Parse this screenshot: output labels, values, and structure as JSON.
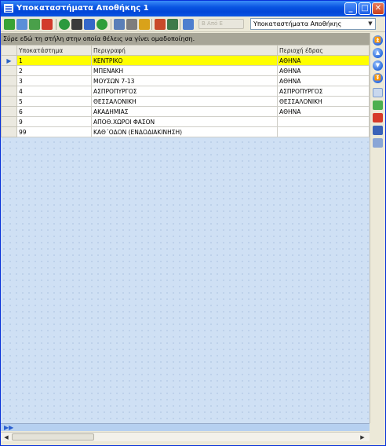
{
  "window": {
    "title": "Υποκαταστήματα Αποθήκης 1",
    "minimize_label": "_",
    "maximize_label": "□",
    "close_label": "✕"
  },
  "toolbar": {
    "disabled_field_text": "Β Από Ε",
    "combo_value": "Υποκαταστήματα Αποθήκης",
    "combo_arrow": "▼",
    "icons": [
      "add-icon",
      "find-icon",
      "edit-icon",
      "delete-icon",
      "help-icon",
      "binoculars-icon",
      "sort-az-icon",
      "refresh-icon",
      "grid-icon",
      "print-preview-icon",
      "wizard-icon",
      "report-icon",
      "stack-icon",
      "copy-icon"
    ]
  },
  "group_panel": {
    "text": "Σύρε εδώ τη στήλη στην οποία θέλεις να γίνει ομαδοποίηση."
  },
  "grid": {
    "columns": [
      "Υποκατάστημα",
      "Περιγραφή",
      "Περιοχή έδρας"
    ],
    "row_indicator": "▶",
    "selected_row": 0,
    "rows": [
      [
        "1",
        "ΚΕΝΤΡΙΚΟ",
        "ΑΘΗΝΑ"
      ],
      [
        "2",
        "ΜΠΕΝΑΚΗ",
        "ΑΘΗΝΑ"
      ],
      [
        "3",
        "ΜΟΥΣΩΝ 7-13",
        "ΑΘΗΝΑ"
      ],
      [
        "4",
        "ΑΣΠΡΟΠΥΡΓΟΣ",
        "ΑΣΠΡΟΠΥΡΓΟΣ"
      ],
      [
        "5",
        "ΘΕΣΣΑΛΟΝΙΚΗ",
        "ΘΕΣΣΑΛΟΝΙΚΗ"
      ],
      [
        "6",
        "ΑΚΑΔΗΜΙΑΣ",
        "ΑΘΗΝΑ"
      ],
      [
        "9",
        "ΑΠΟΘ.ΧΩΡΟΙ ΦΑΣΟΝ",
        ""
      ],
      [
        "99",
        "ΚΑΘ΄ΟΔΟΝ (ΕΝΔΟΔΙΑΚΙΝΗΣΗ)",
        ""
      ]
    ]
  },
  "side_panel": {
    "icons": [
      "first-record-icon",
      "previous-record-icon",
      "next-record-icon",
      "last-record-icon",
      "form-icon",
      "add-record-icon",
      "delete-record-icon",
      "save-icon",
      "copy-record-icon"
    ]
  },
  "footer": {
    "nav_glyph": "▶▶",
    "scroll_left": "◀",
    "scroll_right": "▶"
  },
  "colors": {
    "title_bar": "#0a55e2",
    "selected_row": "#ffff00",
    "grid_background": "#cfe0f4",
    "group_panel": "#a7a597"
  }
}
